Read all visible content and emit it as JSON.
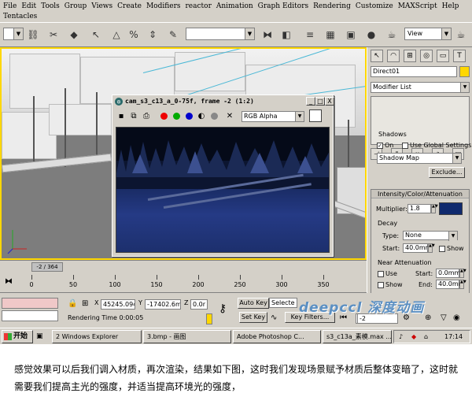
{
  "menu": [
    "File",
    "Edit",
    "Tools",
    "Group",
    "Views",
    "Create",
    "Modifiers",
    "reactor",
    "Animation",
    "Graph Editors",
    "Rendering",
    "Customize",
    "MAXScript",
    "Help",
    "Tentacles"
  ],
  "toolbar": {
    "view_select": "View"
  },
  "render_window": {
    "title": "cam_s3_c13_a_0-75f, frame -2 (1:2)",
    "channel": "RGB Alpha",
    "min": "_",
    "max": "□",
    "close": "X"
  },
  "command_panel": {
    "object_name": "Direct01",
    "modifier_list": "Modifier List",
    "shadows": {
      "title": "Shadows",
      "on_label": "On",
      "global_label": "Use Global Settings",
      "type": "Shadow Map",
      "exclude_label": "Exclude..."
    },
    "intensity": {
      "title": "Intensity/Color/Attenuation",
      "multiplier_label": "Multiplier:",
      "multiplier_value": "1.8",
      "swatch_color": "#102a6e"
    },
    "decay": {
      "title": "Decay",
      "type_label": "Type:",
      "type_value": "None",
      "start_label": "Start:",
      "start_value": "40.0mr",
      "show_label": "Show"
    },
    "near_attenuation": {
      "title": "Near Attenuation",
      "use_label": "Use",
      "start_label": "Start:",
      "start_value": "0.0mm",
      "show_label": "Show",
      "end_label": "End:",
      "end_value": "40.0mm"
    }
  },
  "timeline": {
    "frame_label": "-2 / 364",
    "ticks": [
      "0",
      "50",
      "100",
      "150",
      "200",
      "250",
      "300",
      "350"
    ]
  },
  "status": {
    "x_value": "45245.094",
    "y_value": "-17402.6mi",
    "z_value": "0.0r",
    "rendering_time": "Rendering Time 0:00:05",
    "auto_key": "Auto Key",
    "set_key": "Set Key",
    "selected": "Selecte",
    "key_filters": "Key Filters...",
    "frame_field": "-2"
  },
  "watermark": "deepccl 深度动画",
  "taskbar": {
    "start": "开始",
    "tasks": [
      "2 Windows Explorer",
      "3.bmp - 画图",
      "Adobe Photoshop C...",
      "s3_c13a_素模.max ..."
    ],
    "clock": "17:14"
  },
  "caption": "感觉效果可以后我们调入材质，再次渲染，结果如下图，这时我们发现场景赋予材质后整体变暗了，这时就需要我们提高主光的强度，并适当提高环境光的强度，"
}
